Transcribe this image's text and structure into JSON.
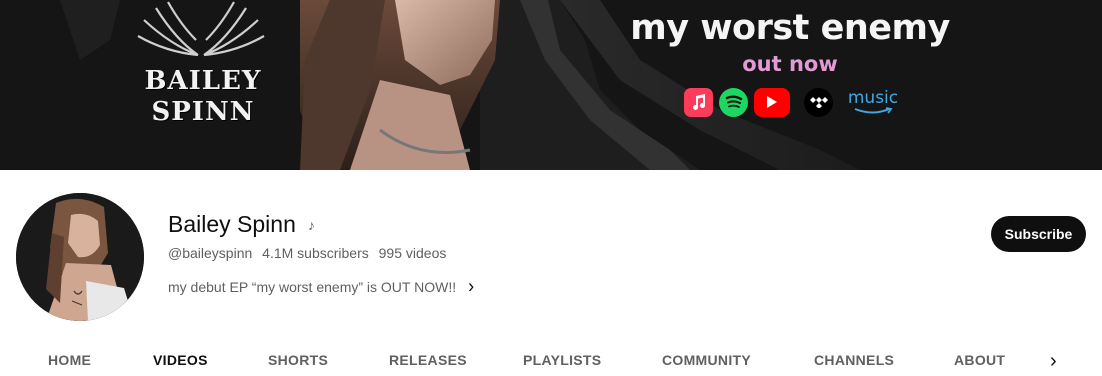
{
  "banner": {
    "brand_line1": "BAILEY",
    "brand_line2": "SPINN",
    "promo_title": "my worst enemy",
    "promo_subtitle": "out now",
    "platforms": [
      "apple-music-icon",
      "spotify-icon",
      "youtube-icon",
      "tidal-icon",
      "amazon-music-icon"
    ],
    "amazon_label": "music",
    "colors": {
      "banner_bg": "#141414",
      "promo_subtitle": "#e29ad4"
    }
  },
  "channel": {
    "name": "Bailey Spinn",
    "badge_icon": "music-note-icon",
    "handle": "@baileyspinn",
    "subscribers": "4.1M subscribers",
    "videos": "995 videos",
    "description": "my debut EP “my worst enemy” is OUT NOW!!",
    "subscribe_label": "Subscribe"
  },
  "tabs": [
    {
      "label": "HOME",
      "active": false
    },
    {
      "label": "VIDEOS",
      "active": true
    },
    {
      "label": "SHORTS",
      "active": false
    },
    {
      "label": "RELEASES",
      "active": false
    },
    {
      "label": "PLAYLISTS",
      "active": false
    },
    {
      "label": "COMMUNITY",
      "active": false
    },
    {
      "label": "CHANNELS",
      "active": false
    },
    {
      "label": "ABOUT",
      "active": false
    }
  ]
}
